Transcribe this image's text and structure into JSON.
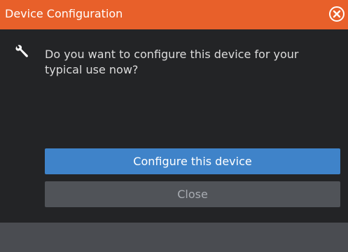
{
  "dialog": {
    "title": "Device Configuration",
    "close_icon": "close-circle-icon",
    "message_icon": "wrench-icon",
    "message": "Do you want to configure this device for your typical use now?",
    "primary_button_label": "Configure this device",
    "secondary_button_label": "Close"
  },
  "colors": {
    "titlebar": "#e8602a",
    "primary_button": "#3f83c9",
    "secondary_button": "#505358",
    "background": "#242527",
    "footer": "#4a4c51"
  }
}
